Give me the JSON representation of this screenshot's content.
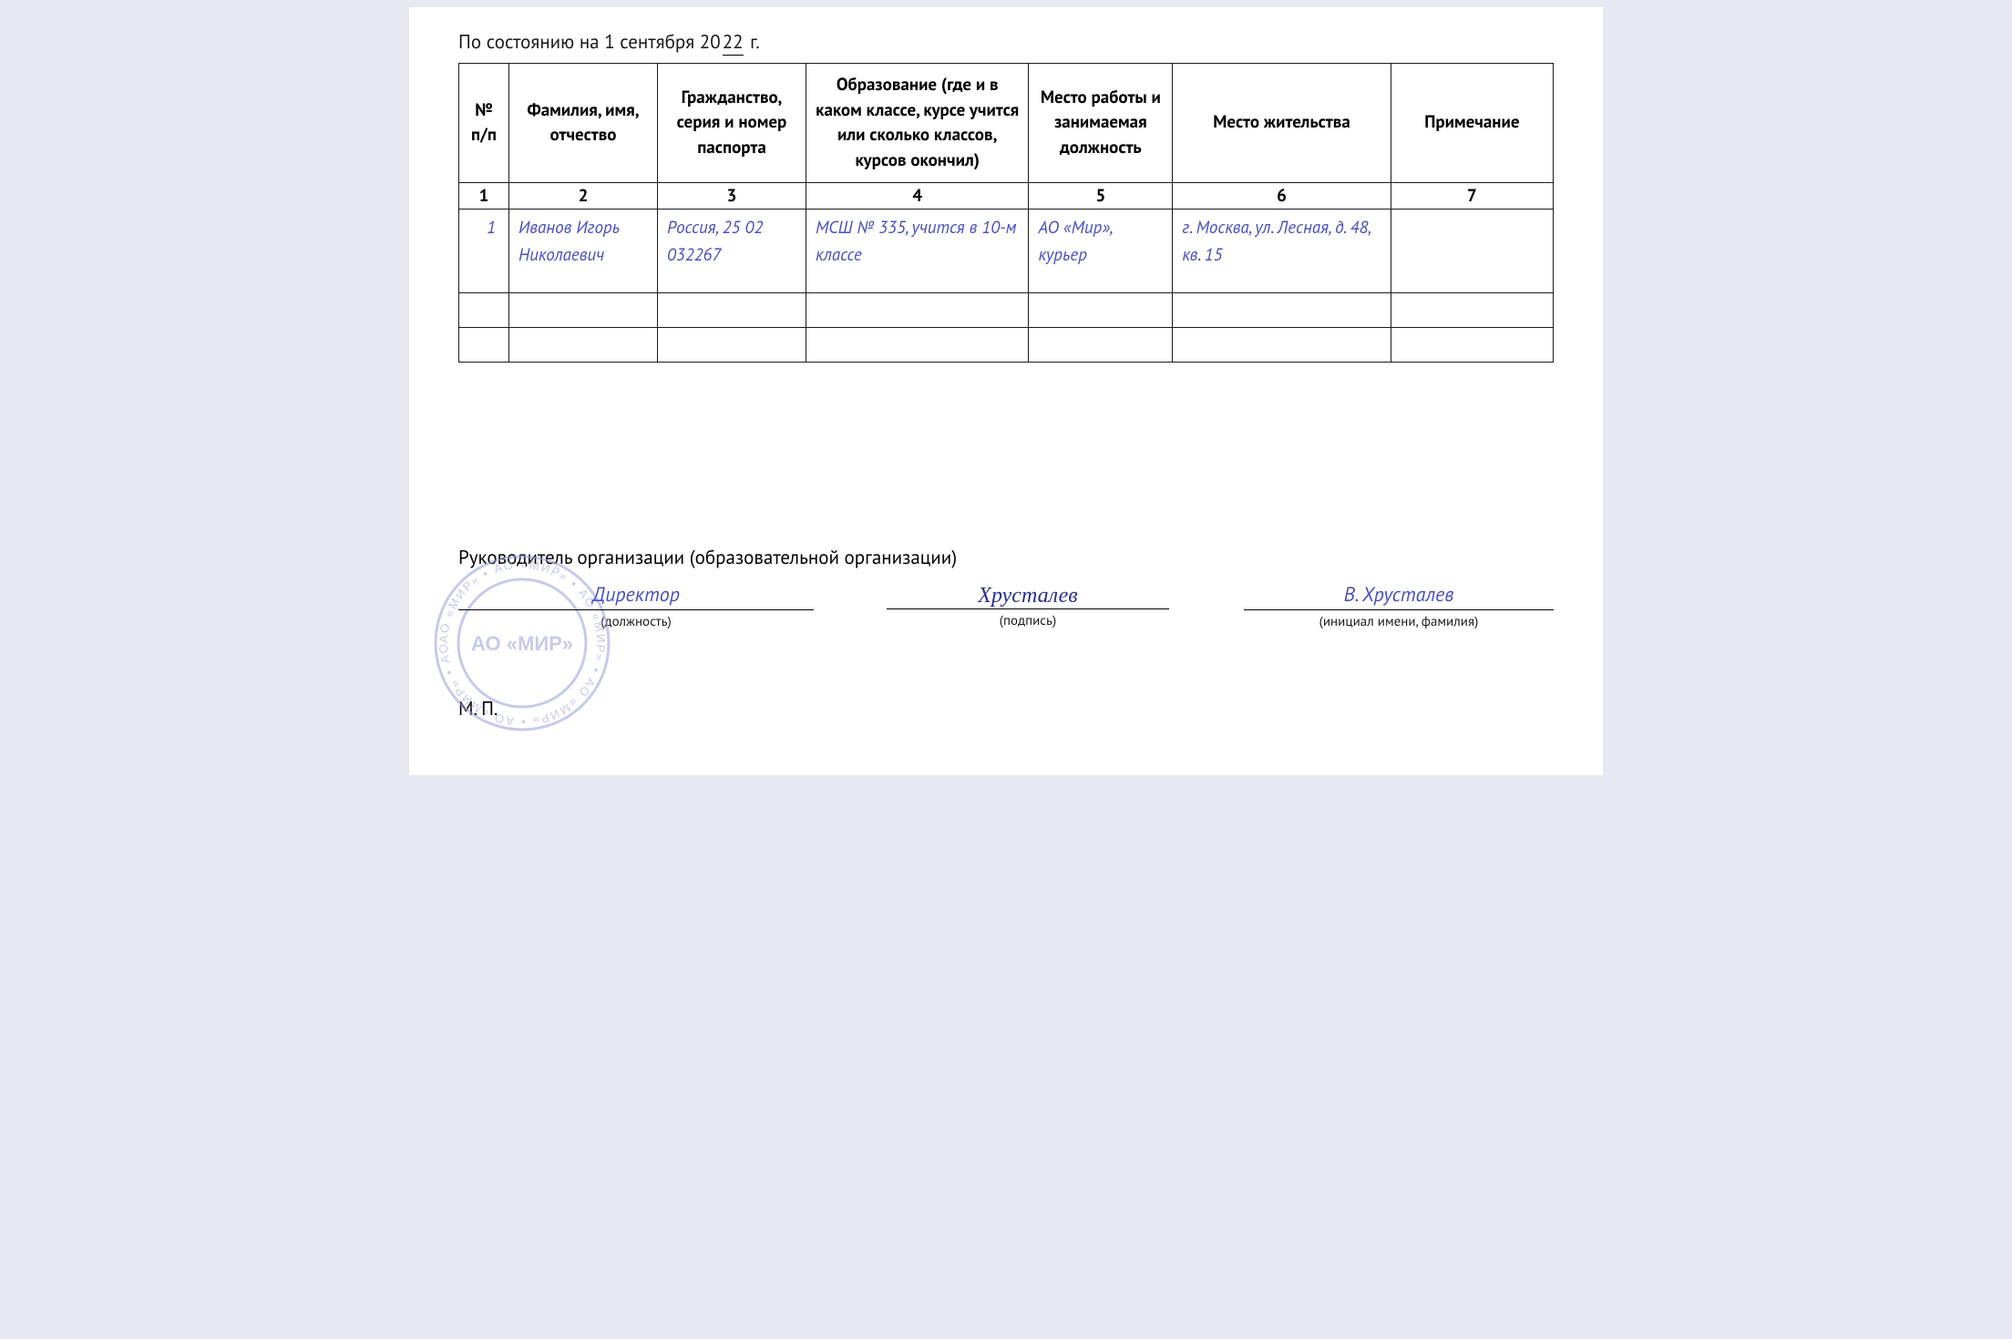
{
  "asof": {
    "prefix": "По состоянию на 1 сентября 20",
    "year": "22",
    "suffix": " г."
  },
  "table": {
    "headers": {
      "c1": "№ п/п",
      "c2": "Фамилия, имя, отчество",
      "c3": "Гражданство, серия и номер паспорта",
      "c4": "Образование (где и в каком классе, курсе учится или сколько классов, курсов окончил)",
      "c5": "Место работы и занимаемая должность",
      "c6": "Место жительства",
      "c7": "Примечание"
    },
    "colnums": {
      "c1": "1",
      "c2": "2",
      "c3": "3",
      "c4": "4",
      "c5": "5",
      "c6": "6",
      "c7": "7"
    },
    "rows": [
      {
        "num": "1",
        "fio": "Иванов Игорь Николаевич",
        "passport": "Россия, 25 02 032267",
        "edu": "МСШ № 335, учится в 10-м классе",
        "job": "АО «Мир», курьер",
        "addr": "г. Москва, ул. Лесная, д. 48, кв. 15",
        "note": ""
      }
    ]
  },
  "footer": {
    "head_line": "Руководитель организации (образовательной организации)",
    "position_value": "Директор",
    "position_label": "(должность)",
    "signature_label": "(подпись)",
    "signature_script": "Хрусталев",
    "name_value": "В. Хрусталев",
    "name_label": "(инициал имени, фамилия)",
    "mp": "М. П.",
    "stamp_text": "АО «МИР»",
    "stamp_ring": "АО «МИР» • АО «МИР» • АО «МИР» • АО «МИР» • АО «МИР» • АО «МИР» • "
  }
}
